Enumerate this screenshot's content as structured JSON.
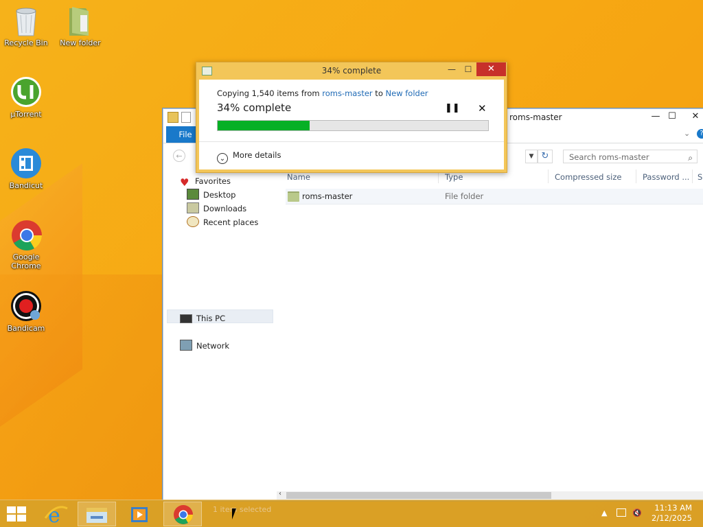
{
  "desktop": {
    "icons": [
      {
        "label": "Recycle Bin",
        "icon": "recycle-bin-icon"
      },
      {
        "label": "New folder",
        "icon": "folder-icon"
      },
      {
        "label": "µTorrent",
        "icon": "utorrent-icon"
      },
      {
        "label": "Bandicut",
        "icon": "bandicut-icon"
      },
      {
        "label": "Google Chrome",
        "icon": "chrome-icon"
      },
      {
        "label": "Bandicam",
        "icon": "bandicam-icon"
      }
    ]
  },
  "explorer": {
    "title": "roms-master",
    "file_tab": "File",
    "search_placeholder": "Search roms-master",
    "nav": {
      "favorites": "Favorites",
      "desktop": "Desktop",
      "downloads": "Downloads",
      "recent": "Recent places",
      "this_pc": "This PC",
      "network": "Network"
    },
    "columns": [
      "Name",
      "Type",
      "Compressed size",
      "Password ...",
      "Si"
    ],
    "rows": [
      {
        "name": "roms-master",
        "type": "File folder"
      }
    ],
    "status": "1 item selected"
  },
  "copy_dialog": {
    "title": "34% complete",
    "copy_prefix": "Copying 1,540 items from ",
    "source": "roms-master",
    "to_word": " to ",
    "destination": "New folder",
    "progress_label": "34% complete",
    "progress": 0.34,
    "more_details": "More details",
    "colors": {
      "progress_fill": "#06b025",
      "link": "#1f6ab5",
      "close": "#c7302a"
    }
  },
  "taskbar": {
    "time": "11:13 AM",
    "date": "2/12/2025",
    "items": [
      "start-icon",
      "internet-explorer-icon",
      "file-explorer-icon",
      "media-player-icon",
      "chrome-icon"
    ]
  }
}
